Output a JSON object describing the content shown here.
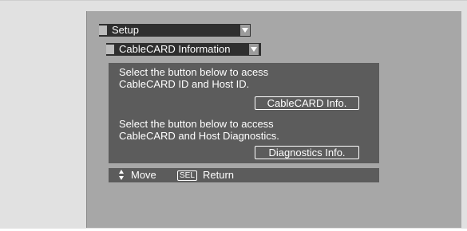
{
  "menu": {
    "setup_title": "Setup",
    "submenu_title": "CableCARD Information"
  },
  "panel": {
    "text1_line1": "Select the button below to acess",
    "text1_line2": "CableCARD ID and Host ID.",
    "button1_label": "CableCARD Info.",
    "text2_line1": "Select the button below to access",
    "text2_line2": "CableCARD and Host Diagnostics.",
    "button2_label": "Diagnostics Info."
  },
  "footer": {
    "move_label": "Move",
    "sel_key": "SEL",
    "return_label": "Return"
  },
  "icons": {
    "setup_tab": "menu-tab-icon",
    "setup_chevron": "chevron-down-icon",
    "cc_tab": "menu-tab-icon",
    "cc_chevron": "chevron-down-icon",
    "updown": "up-down-arrows-icon"
  },
  "colors": {
    "background_outer": "#e1e1e1",
    "screen": "#a7a7a7",
    "bar": "#2f2f2f",
    "panel": "#5c5c5c",
    "text": "#ffffff"
  }
}
